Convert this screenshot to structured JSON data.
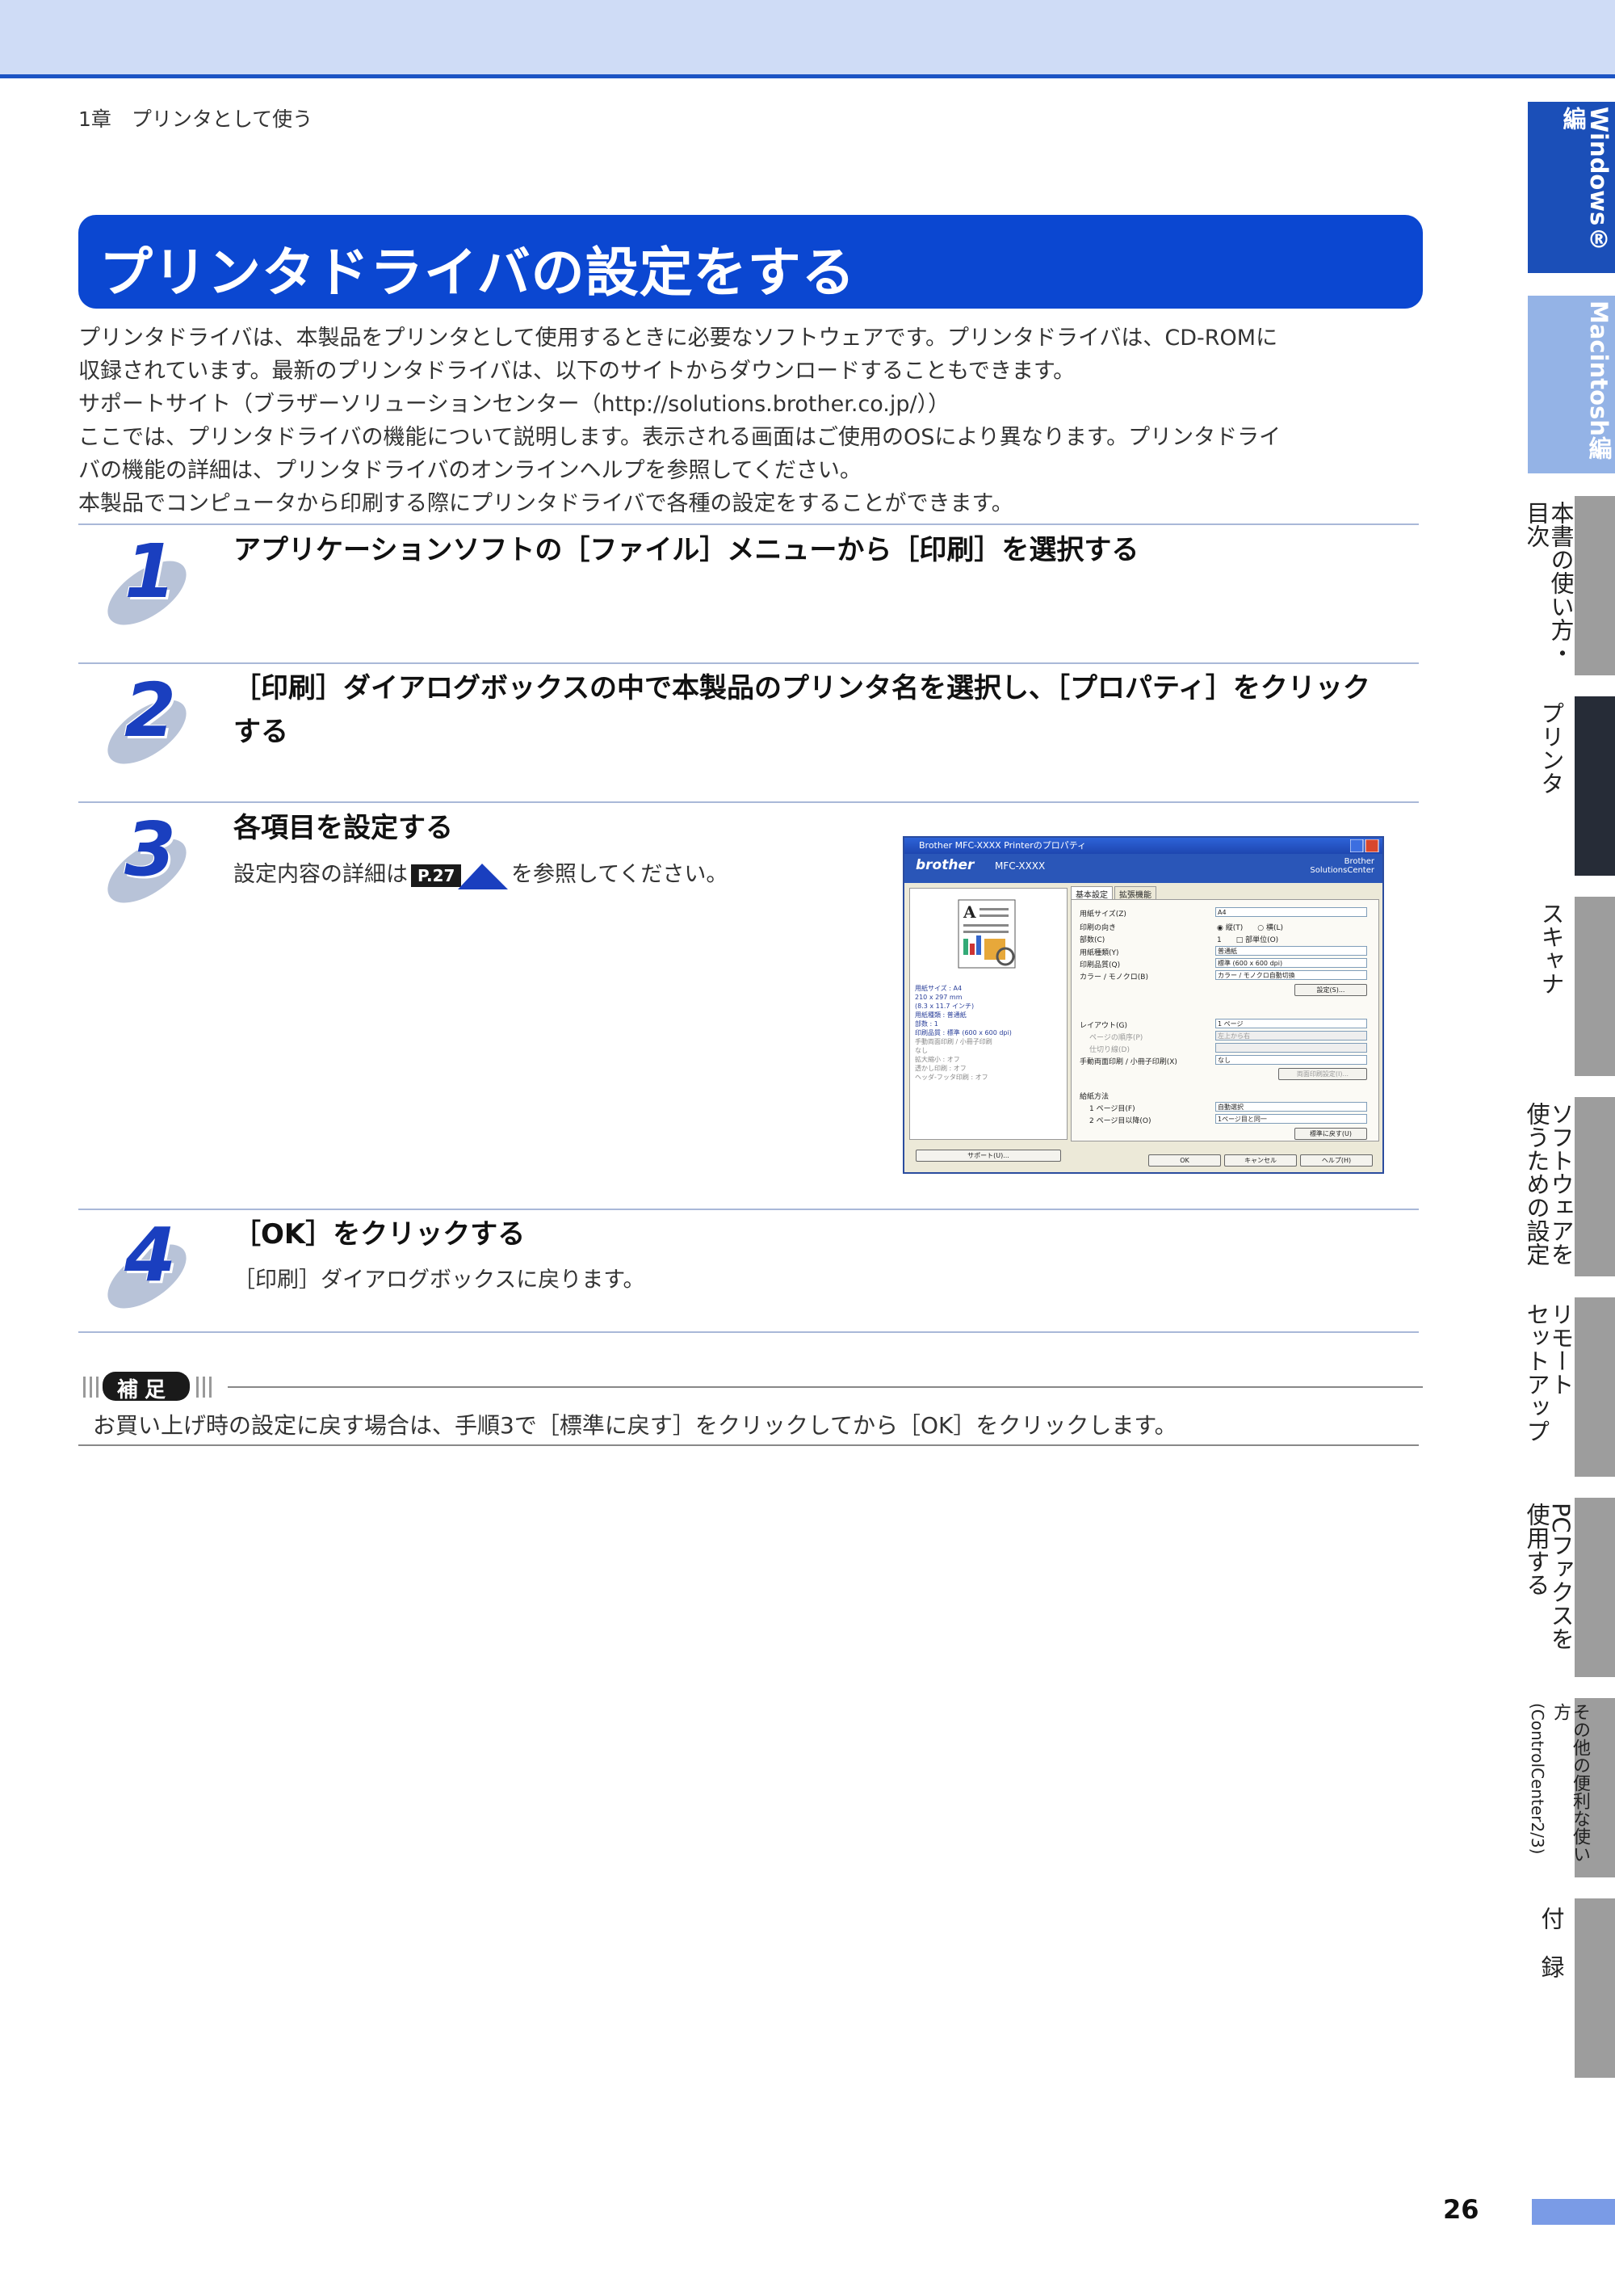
{
  "header": {
    "chapter": "1章　プリンタとして使う"
  },
  "page_title": "プリンタドライバの設定をする",
  "intro_lines": [
    "プリンタドライバは、本製品をプリンタとして使用するときに必要なソフトウェアです。プリンタドライバは、CD-ROMに",
    "収録されています。最新のプリンタドライバは、以下のサイトからダウンロードすることもできます。",
    "サポートサイト（ブラザーソリューションセンター（http://solutions.brother.co.jp/））",
    "ここでは、プリンタドライバの機能について説明します。表示される画面はご使用のOSにより異なります。プリンタドライ",
    "バの機能の詳細は、プリンタドライバのオンラインヘルプを参照してください。",
    "本製品でコンピュータから印刷する際にプリンタドライバで各種の設定をすることができます。"
  ],
  "steps": [
    {
      "num": "1",
      "title": "アプリケーションソフトの［ファイル］メニューから［印刷］を選択する"
    },
    {
      "num": "2",
      "title": "［印刷］ダイアログボックスの中で本製品のプリンタ名を選択し、［プロパティ］をクリック",
      "title2": "する"
    },
    {
      "num": "3",
      "title": "各項目を設定する",
      "desc_before": "設定内容の詳細は",
      "ref": "P.27",
      "desc_after": "を参照してください。"
    },
    {
      "num": "4",
      "title": "［OK］をクリックする",
      "desc": "［印刷］ダイアログボックスに戻ります。"
    }
  ],
  "dialog": {
    "titlebar": "Brother MFC-XXXX Printerのプロパティ",
    "brand": "brother",
    "model": "MFC-XXXX",
    "solutions": [
      "Brother",
      "SolutionsCenter"
    ],
    "tabs": [
      "基本設定",
      "拡張機能"
    ],
    "fields": [
      {
        "label": "用紙サイズ(Z)",
        "value": "A4"
      },
      {
        "label": "印刷の向き",
        "value": "◉ 縦(T)　　○ 横(L)"
      },
      {
        "label": "部数(C)",
        "value": "1　　□ 部単位(O)"
      },
      {
        "label": "用紙種類(Y)",
        "value": "普通紙"
      },
      {
        "label": "印刷品質(Q)",
        "value": "標準 (600 x 600 dpi)"
      },
      {
        "label": "カラー / モノクロ(B)",
        "value": "カラー / モノクロ自動切換"
      }
    ],
    "settings_button": "設定(S)...",
    "layout_fields": [
      {
        "label": "レイアウト(G)",
        "value": "1 ページ"
      },
      {
        "label": "ページの順序(P)",
        "value": "左上から右"
      },
      {
        "label": "仕切り線(D)",
        "value": ""
      },
      {
        "label": "手動両面印刷 / 小冊子印刷(X)",
        "value": "なし"
      }
    ],
    "duplex_button": "両面印刷設定(I)...",
    "feed_label": "給紙方法",
    "feed_fields": [
      {
        "label": "1 ページ目(F)",
        "value": "自動選択"
      },
      {
        "label": "2 ページ目以降(O)",
        "value": "1ページ目と同一"
      }
    ],
    "default_button": "標準に戻す(U)",
    "support_button": "サポート(U)...",
    "ok_button": "OK",
    "cancel_button": "キャンセル",
    "help_button": "ヘルプ(H)",
    "preview_info": [
      "用紙サイズ : A4",
      "210 x 297 mm",
      "(8.3 x 11.7 インチ)",
      "用紙種類 : 普通紙",
      "部数 : 1",
      "印刷品質 : 標準 (600 x 600 dpi)",
      "手動両面印刷 / 小冊子印刷",
      "なし",
      "拡大縮小 : オフ",
      "透かし印刷 : オフ",
      "ヘッダ-フッタ印刷 : オフ"
    ]
  },
  "hosoku": {
    "label": "補足",
    "text": "お買い上げ時の設定に戻す場合は、手順3で［標準に戻す］をクリックしてから［OK］をクリックします。"
  },
  "side_tabs": [
    {
      "text": "Windows®編",
      "style": "blue"
    },
    {
      "text": "Macintosh編",
      "style": "lightblue"
    },
    {
      "text": "本書の使い方・",
      "text2": "目次",
      "style": "grey"
    },
    {
      "text": "プリンタ",
      "style": "dark"
    },
    {
      "text": "スキャナ",
      "style": "grey"
    },
    {
      "text": "ソフトウェアを",
      "text2": "使うための設定",
      "style": "grey"
    },
    {
      "text": "リモート",
      "text2": "セットアップ",
      "style": "grey"
    },
    {
      "text": "PCファクスを",
      "text2": "使用する",
      "style": "grey"
    },
    {
      "text": "その他の便利な使い方",
      "text2": "(ControlCenter2/3)",
      "style": "grey"
    },
    {
      "text": "付",
      "text2": "録",
      "style": "grey"
    }
  ],
  "page_number": "26",
  "colors": {
    "accent": "#0b47d1",
    "band": "#cfdcf6",
    "sidebar_active": "#262c37"
  }
}
